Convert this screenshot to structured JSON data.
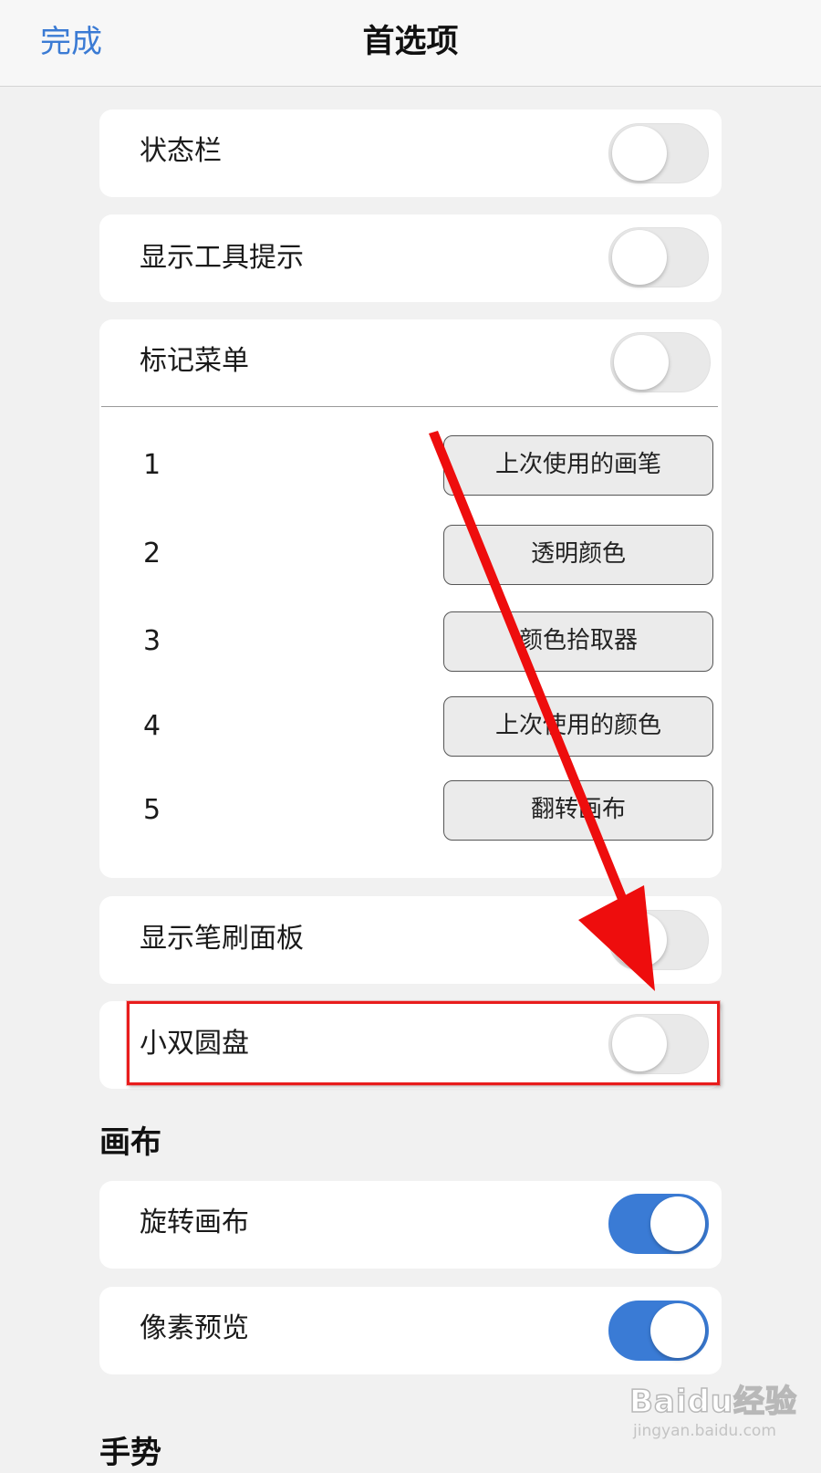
{
  "nav": {
    "done_label": "完成",
    "title": "首选项"
  },
  "rows": {
    "status_bar": {
      "label": "状态栏",
      "enabled": false
    },
    "tooltips": {
      "label": "显示工具提示",
      "enabled": false
    },
    "marking_menu": {
      "label": "标记菜单",
      "enabled": false
    },
    "brush_panel": {
      "label": "显示笔刷面板",
      "enabled": false
    },
    "double_puck": {
      "label": "小双圆盘",
      "enabled": false
    },
    "rotate_canvas": {
      "label": "旋转画布",
      "enabled": true
    },
    "pixel_preview": {
      "label": "像素预览",
      "enabled": true
    }
  },
  "marking_menu_items": [
    {
      "num": "1",
      "action": "上次使用的画笔"
    },
    {
      "num": "2",
      "action": "透明颜色"
    },
    {
      "num": "3",
      "action": "颜色拾取器"
    },
    {
      "num": "4",
      "action": "上次使用的颜色"
    },
    {
      "num": "5",
      "action": "翻转画布"
    }
  ],
  "sections": {
    "canvas": "画布",
    "gestures": "手势"
  },
  "watermark": {
    "brand": "Baidu经验",
    "url": "jingyan.baidu.com"
  },
  "colors": {
    "accent": "#3a7bd5",
    "annotation": "#e81c1c",
    "background": "#f1f1f1"
  }
}
